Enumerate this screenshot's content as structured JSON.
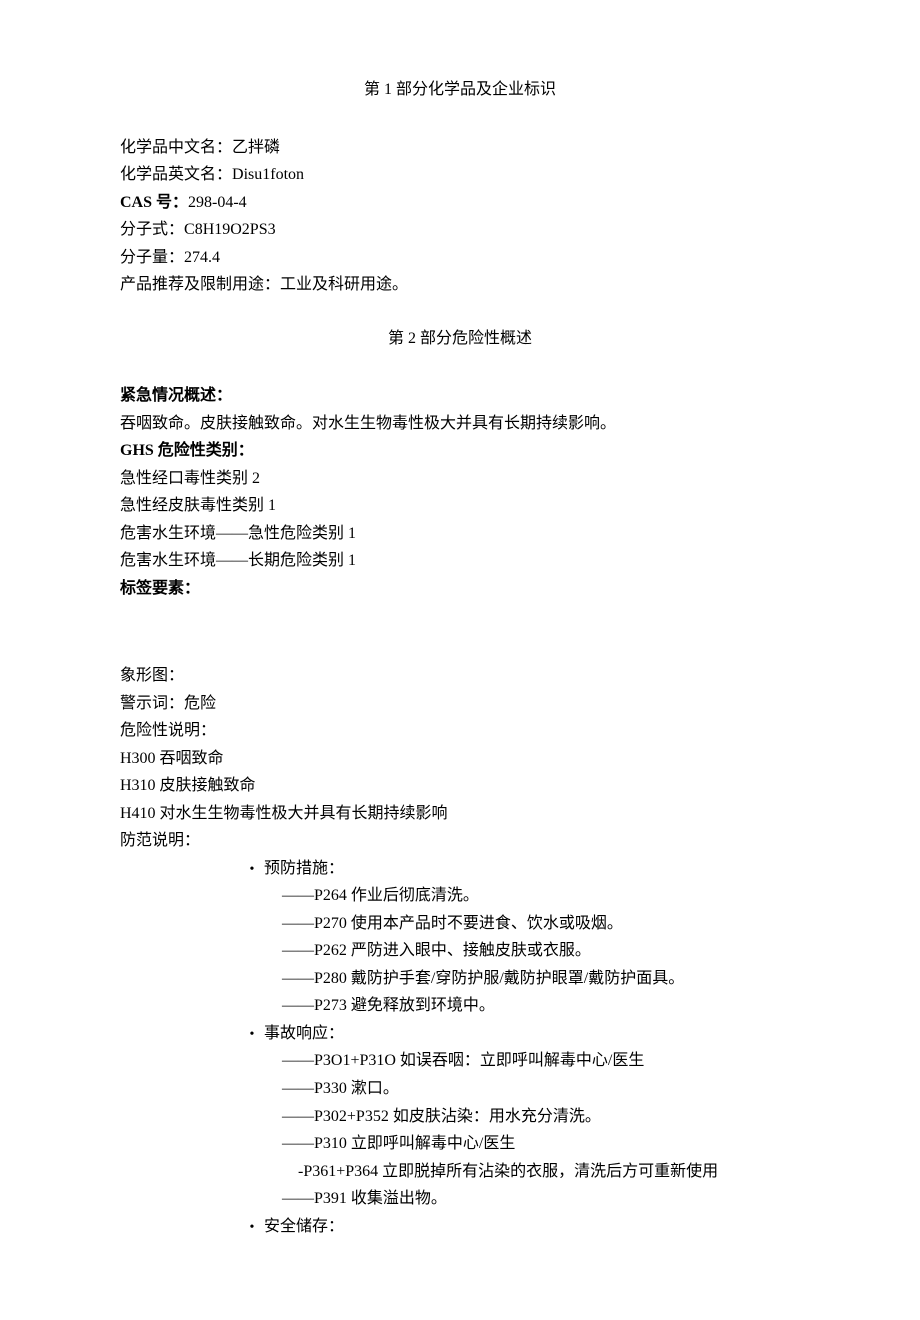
{
  "section1": {
    "title": "第 1 部分化学品及企业标识",
    "name_cn_label": "化学品中文名：",
    "name_cn_value": "乙拌磷",
    "name_en_label": "化学品英文名：",
    "name_en_value": "Disu1foton",
    "cas_label": "CAS 号：",
    "cas_value": "298-04-4",
    "formula_label": "分子式：",
    "formula_value": "C8H19O2PS3",
    "mw_label": "分子量：",
    "mw_value": "274.4",
    "use_label": "产品推荐及限制用途：",
    "use_value": "工业及科研用途。"
  },
  "section2": {
    "title": "第 2 部分危险性概述",
    "emergency_label": "紧急情况概述：",
    "emergency_text": "吞咽致命。皮肤接触致命。对水生生物毒性极大并具有长期持续影响。",
    "ghs_label": "GHS 危险性类别：",
    "ghs_lines": [
      "急性经口毒性类别 2",
      "急性经皮肤毒性类别 1",
      "危害水生环境——急性危险类别 1",
      "危害水生环境——长期危险类别 1"
    ],
    "label_elements": "标签要素：",
    "pictogram": "象形图：",
    "signal_label": "警示词：",
    "signal_value": "危险",
    "hazard_label": "危险性说明：",
    "hazard_lines": [
      "H300 吞咽致命",
      "H310 皮肤接触致命",
      "H410 对水生生物毒性极大并具有长期持续影响"
    ],
    "precaution_label": "防范说明：",
    "bullets": [
      {
        "title": "预防措施：",
        "items": [
          {
            "prefix": "——",
            "text": "P264 作业后彻底清洗。"
          },
          {
            "prefix": "——",
            "text": "P270 使用本产品时不要进食、饮水或吸烟。"
          },
          {
            "prefix": "——",
            "text": "P262 严防进入眼中、接触皮肤或衣服。"
          },
          {
            "prefix": "——",
            "text": "P280 戴防护手套/穿防护服/戴防护眼罩/戴防护面具。"
          },
          {
            "prefix": "——",
            "text": "P273 避免释放到环境中。"
          }
        ]
      },
      {
        "title": "事故响应：",
        "items": [
          {
            "prefix": "——",
            "text": "P3O1+P31O 如误吞咽：立即呼叫解毒中心/医生"
          },
          {
            "prefix": "——",
            "text": "P330 漱口。"
          },
          {
            "prefix": "——",
            "text": "P302+P352 如皮肤沾染：用水充分清洗。"
          },
          {
            "prefix": "——",
            "text": "P310 立即呼叫解毒中心/医生"
          },
          {
            "prefix": "-",
            "text": "P361+P364 立即脱掉所有沾染的衣服，清洗后方可重新使用"
          },
          {
            "prefix": "——",
            "text": "P391 收集溢出物。"
          }
        ]
      },
      {
        "title": "安全储存：",
        "items": []
      }
    ]
  }
}
